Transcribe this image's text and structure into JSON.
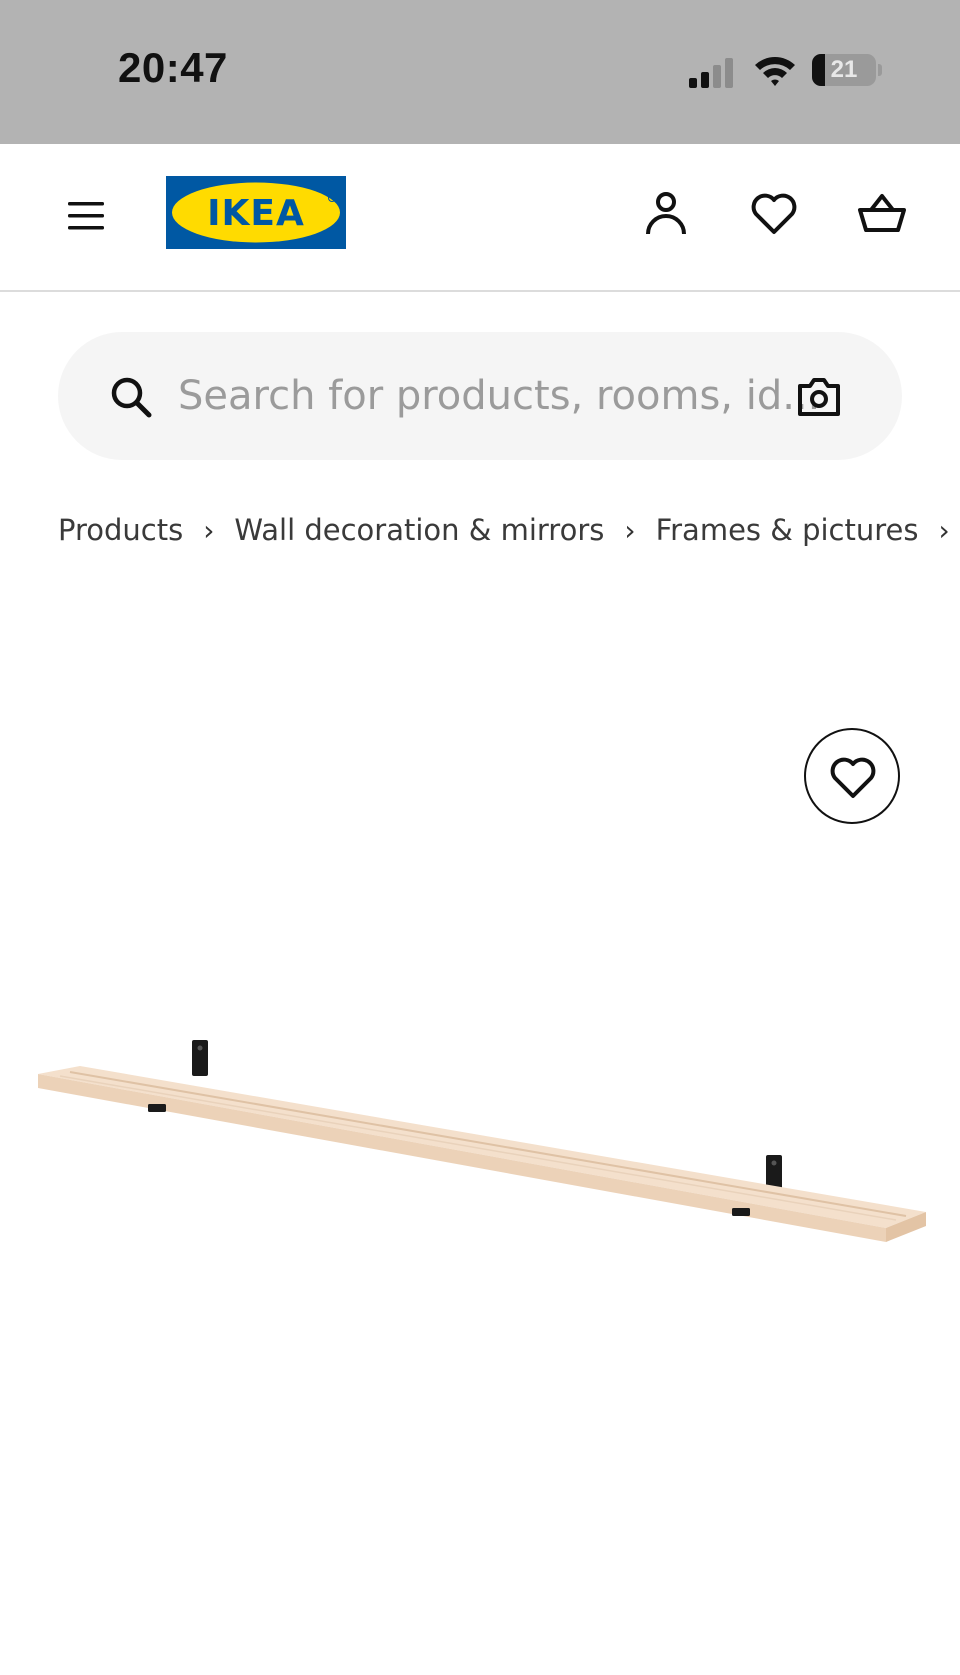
{
  "status_bar": {
    "time": "20:47",
    "battery_level": "21",
    "battery_fraction": 0.21,
    "icons": [
      "signal-icon",
      "wifi-icon",
      "battery-icon"
    ]
  },
  "header": {
    "logo_text": "IKEA",
    "icons": [
      "menu-icon",
      "account-icon",
      "wishlist-icon",
      "basket-icon"
    ]
  },
  "search": {
    "placeholder": "Search for products, rooms, id..."
  },
  "breadcrumb": {
    "items": [
      "Products",
      "Wall decoration & mirrors",
      "Frames & pictures"
    ],
    "separator": "›"
  },
  "product": {
    "image_alt": "Picture ledge",
    "favourite_icon": "heart-icon"
  },
  "colors": {
    "status_bar_bg": "#b3b3b3",
    "ikea_blue": "#0058a3",
    "ikea_yellow": "#ffdb00",
    "search_bg": "#f5f5f5",
    "wood": "#f2dcc6"
  }
}
